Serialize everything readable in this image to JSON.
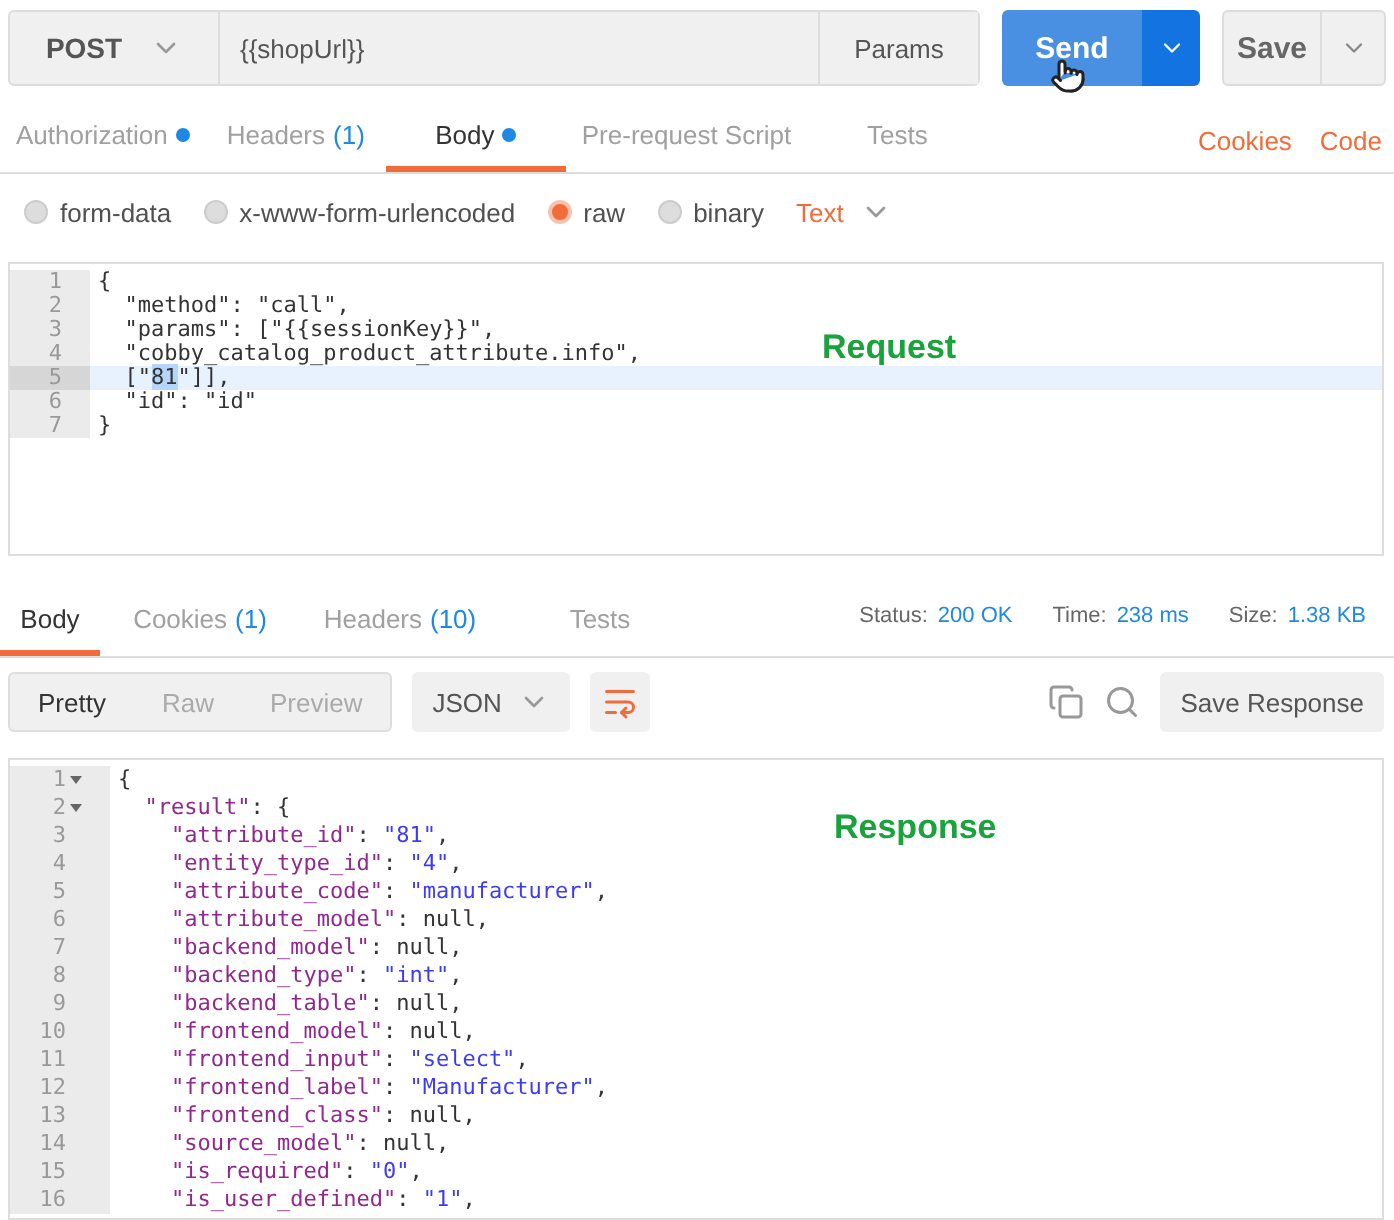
{
  "request_bar": {
    "method": "POST",
    "url": "{{shopUrl}}",
    "params_button": "Params",
    "send_button": "Send",
    "save_button": "Save"
  },
  "request_tabs": [
    {
      "label": "Authorization",
      "dot": true,
      "selected": false
    },
    {
      "label": "Headers",
      "count": "(1)",
      "dot": false,
      "selected": false
    },
    {
      "label": "Body",
      "dot": true,
      "selected": true
    },
    {
      "label": "Pre-request Script",
      "dot": false,
      "selected": false
    },
    {
      "label": "Tests",
      "dot": false,
      "selected": false
    }
  ],
  "request_links": [
    "Cookies",
    "Code"
  ],
  "body_types": [
    {
      "label": "form-data",
      "selected": false
    },
    {
      "label": "x-www-form-urlencoded",
      "selected": false
    },
    {
      "label": "raw",
      "selected": true
    },
    {
      "label": "binary",
      "selected": false
    }
  ],
  "body_format": "Text",
  "request_editor": {
    "annotation": "Request",
    "lines": [
      {
        "number": "1",
        "active": false,
        "parts": [
          {
            "text": "{",
            "selected": false
          }
        ]
      },
      {
        "number": "2",
        "active": false,
        "parts": [
          {
            "text": "  \"method\": \"call\",",
            "selected": false
          }
        ]
      },
      {
        "number": "3",
        "active": false,
        "parts": [
          {
            "text": "  \"params\": [\"{{sessionKey}}\",",
            "selected": false
          }
        ]
      },
      {
        "number": "4",
        "active": false,
        "parts": [
          {
            "text": "  \"cobby_catalog_product_attribute.info\",",
            "selected": false
          }
        ]
      },
      {
        "number": "5",
        "active": true,
        "parts": [
          {
            "text": "  [\"",
            "selected": false
          },
          {
            "text": "81",
            "selected": true
          },
          {
            "text": "\"]],",
            "selected": false
          }
        ]
      },
      {
        "number": "6",
        "active": false,
        "parts": [
          {
            "text": "  \"id\": \"id\"",
            "selected": false
          }
        ]
      },
      {
        "number": "7",
        "active": false,
        "parts": [
          {
            "text": "}",
            "selected": false
          }
        ]
      }
    ]
  },
  "response_tabs": [
    {
      "label": "Body",
      "selected": true
    },
    {
      "label": "Cookies",
      "count": "(1)",
      "selected": false
    },
    {
      "label": "Headers",
      "count": "(10)",
      "selected": false
    },
    {
      "label": "Tests",
      "selected": false
    }
  ],
  "response_stats": [
    {
      "label": "Status:",
      "value": "200 OK"
    },
    {
      "label": "Time:",
      "value": "238 ms"
    },
    {
      "label": "Size:",
      "value": "1.38 KB"
    }
  ],
  "view_modes": [
    {
      "label": "Pretty",
      "selected": true
    },
    {
      "label": "Raw",
      "selected": false
    },
    {
      "label": "Preview",
      "selected": false
    }
  ],
  "response_format": "JSON",
  "save_response_button": "Save Response",
  "response_editor": {
    "annotation": "Response",
    "lines": [
      {
        "number": "1",
        "foldable": true,
        "parts": [
          {
            "kind": "punct",
            "text": "{"
          }
        ]
      },
      {
        "number": "2",
        "foldable": true,
        "parts": [
          {
            "kind": "key",
            "text": "  \"result\""
          },
          {
            "kind": "punct",
            "text": ": {"
          }
        ]
      },
      {
        "number": "3",
        "foldable": false,
        "parts": [
          {
            "kind": "key",
            "text": "    \"attribute_id\""
          },
          {
            "kind": "punct",
            "text": ": "
          },
          {
            "kind": "string",
            "text": "\"81\""
          },
          {
            "kind": "punct",
            "text": ","
          }
        ]
      },
      {
        "number": "4",
        "foldable": false,
        "parts": [
          {
            "kind": "key",
            "text": "    \"entity_type_id\""
          },
          {
            "kind": "punct",
            "text": ": "
          },
          {
            "kind": "string",
            "text": "\"4\""
          },
          {
            "kind": "punct",
            "text": ","
          }
        ]
      },
      {
        "number": "5",
        "foldable": false,
        "parts": [
          {
            "kind": "key",
            "text": "    \"attribute_code\""
          },
          {
            "kind": "punct",
            "text": ": "
          },
          {
            "kind": "string",
            "text": "\"manufacturer\""
          },
          {
            "kind": "punct",
            "text": ","
          }
        ]
      },
      {
        "number": "6",
        "foldable": false,
        "parts": [
          {
            "kind": "key",
            "text": "    \"attribute_model\""
          },
          {
            "kind": "punct",
            "text": ": null,"
          }
        ]
      },
      {
        "number": "7",
        "foldable": false,
        "parts": [
          {
            "kind": "key",
            "text": "    \"backend_model\""
          },
          {
            "kind": "punct",
            "text": ": null,"
          }
        ]
      },
      {
        "number": "8",
        "foldable": false,
        "parts": [
          {
            "kind": "key",
            "text": "    \"backend_type\""
          },
          {
            "kind": "punct",
            "text": ": "
          },
          {
            "kind": "string",
            "text": "\"int\""
          },
          {
            "kind": "punct",
            "text": ","
          }
        ]
      },
      {
        "number": "9",
        "foldable": false,
        "parts": [
          {
            "kind": "key",
            "text": "    \"backend_table\""
          },
          {
            "kind": "punct",
            "text": ": null,"
          }
        ]
      },
      {
        "number": "10",
        "foldable": false,
        "parts": [
          {
            "kind": "key",
            "text": "    \"frontend_model\""
          },
          {
            "kind": "punct",
            "text": ": null,"
          }
        ]
      },
      {
        "number": "11",
        "foldable": false,
        "parts": [
          {
            "kind": "key",
            "text": "    \"frontend_input\""
          },
          {
            "kind": "punct",
            "text": ": "
          },
          {
            "kind": "string",
            "text": "\"select\""
          },
          {
            "kind": "punct",
            "text": ","
          }
        ]
      },
      {
        "number": "12",
        "foldable": false,
        "parts": [
          {
            "kind": "key",
            "text": "    \"frontend_label\""
          },
          {
            "kind": "punct",
            "text": ": "
          },
          {
            "kind": "string",
            "text": "\"Manufacturer\""
          },
          {
            "kind": "punct",
            "text": ","
          }
        ]
      },
      {
        "number": "13",
        "foldable": false,
        "parts": [
          {
            "kind": "key",
            "text": "    \"frontend_class\""
          },
          {
            "kind": "punct",
            "text": ": null,"
          }
        ]
      },
      {
        "number": "14",
        "foldable": false,
        "parts": [
          {
            "kind": "key",
            "text": "    \"source_model\""
          },
          {
            "kind": "punct",
            "text": ": null,"
          }
        ]
      },
      {
        "number": "15",
        "foldable": false,
        "parts": [
          {
            "kind": "key",
            "text": "    \"is_required\""
          },
          {
            "kind": "punct",
            "text": ": "
          },
          {
            "kind": "string",
            "text": "\"0\""
          },
          {
            "kind": "punct",
            "text": ","
          }
        ]
      },
      {
        "number": "16",
        "foldable": false,
        "parts": [
          {
            "kind": "key",
            "text": "    \"is_user_defined\""
          },
          {
            "kind": "punct",
            "text": ": "
          },
          {
            "kind": "string",
            "text": "\"1\""
          },
          {
            "kind": "punct",
            "text": ","
          }
        ]
      }
    ]
  }
}
